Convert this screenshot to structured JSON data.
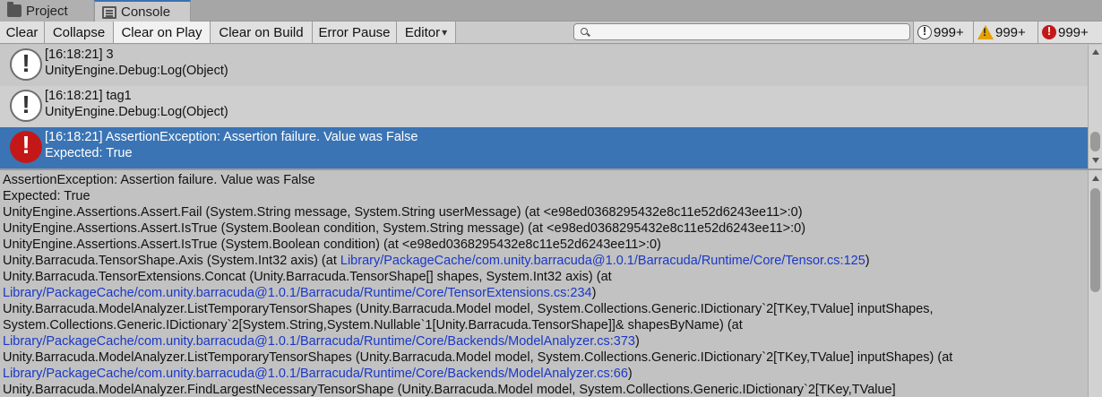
{
  "tabs": {
    "project": "Project",
    "console": "Console"
  },
  "toolbar": {
    "clear": "Clear",
    "collapse": "Collapse",
    "clear_on_play": "Clear on Play",
    "clear_on_build": "Clear on Build",
    "error_pause": "Error Pause",
    "editor": "Editor",
    "editor_arrow": "▾",
    "search_value": "",
    "info_count": "999+",
    "warning_count": "999+",
    "error_count": "999+"
  },
  "logs": [
    {
      "line1": "[16:18:21] 3",
      "line2": "UnityEngine.Debug:Log(Object)",
      "type": "info"
    },
    {
      "line1": "[16:18:21] tag1",
      "line2": "UnityEngine.Debug:Log(Object)",
      "type": "info"
    },
    {
      "line1": "[16:18:21] AssertionException: Assertion failure. Value was False",
      "line2": "Expected: True",
      "type": "error"
    }
  ],
  "detail": {
    "l0": "AssertionException: Assertion failure. Value was False",
    "l1": "Expected: True",
    "l2": "UnityEngine.Assertions.Assert.Fail (System.String message, System.String userMessage) (at <e98ed0368295432e8c11e52d6243ee11>:0)",
    "l3": "UnityEngine.Assertions.Assert.IsTrue (System.Boolean condition, System.String message) (at <e98ed0368295432e8c11e52d6243ee11>:0)",
    "l4": "UnityEngine.Assertions.Assert.IsTrue (System.Boolean condition) (at <e98ed0368295432e8c11e52d6243ee11>:0)",
    "l5_text": "Unity.Barracuda.TensorShape.Axis (System.Int32 axis) (at ",
    "l5_link": "Library/PackageCache/com.unity.barracuda@1.0.1/Barracuda/Runtime/Core/Tensor.cs:125",
    "l5_end": ")",
    "l6": "Unity.Barracuda.TensorExtensions.Concat (Unity.Barracuda.TensorShape[] shapes, System.Int32 axis) (at",
    "l7_link": "Library/PackageCache/com.unity.barracuda@1.0.1/Barracuda/Runtime/Core/TensorExtensions.cs:234",
    "l7_end": ")",
    "l8": "Unity.Barracuda.ModelAnalyzer.ListTemporaryTensorShapes (Unity.Barracuda.Model model, System.Collections.Generic.IDictionary`2[TKey,TValue] inputShapes,",
    "l9": "System.Collections.Generic.IDictionary`2[System.String,System.Nullable`1[Unity.Barracuda.TensorShape]]& shapesByName) (at",
    "l10_link": "Library/PackageCache/com.unity.barracuda@1.0.1/Barracuda/Runtime/Core/Backends/ModelAnalyzer.cs:373",
    "l10_end": ")",
    "l11": "Unity.Barracuda.ModelAnalyzer.ListTemporaryTensorShapes (Unity.Barracuda.Model model, System.Collections.Generic.IDictionary`2[TKey,TValue] inputShapes) (at",
    "l12_link": "Library/PackageCache/com.unity.barracuda@1.0.1/Barracuda/Runtime/Core/Backends/ModelAnalyzer.cs:66",
    "l12_end": ")",
    "l13": "Unity.Barracuda.ModelAnalyzer.FindLargestNecessaryTensorShape (Unity.Barracuda.Model model, System.Collections.Generic.IDictionary`2[TKey,TValue]"
  }
}
